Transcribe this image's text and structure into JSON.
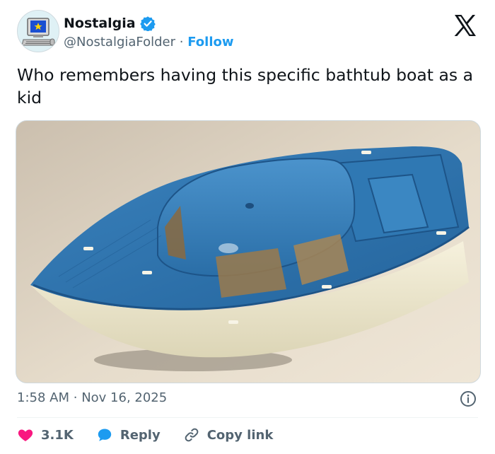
{
  "author": {
    "name": "Nostalgia",
    "handle": "@NostalgiaFolder",
    "separator": "·",
    "follow_label": "Follow",
    "verified_icon": "verified-badge-icon",
    "avatar_icon": "retro-computer-folder-avatar"
  },
  "tweet": {
    "text": "Who remembers having this specific bathtub boat as a kid",
    "media_icon": "blue-white-toy-boat-photo"
  },
  "meta": {
    "time": "1:58 AM",
    "separator": "·",
    "date": "Nov 16, 2025"
  },
  "actions": {
    "like_count": "3.1K",
    "reply_label": "Reply",
    "copy_label": "Copy link"
  },
  "colors": {
    "accent": "#1d9bf0",
    "like": "#f91880",
    "text_primary": "#0f1419",
    "text_secondary": "#536471",
    "boat_blue": "#2a6fa8",
    "boat_cream": "#f1ecd2"
  }
}
